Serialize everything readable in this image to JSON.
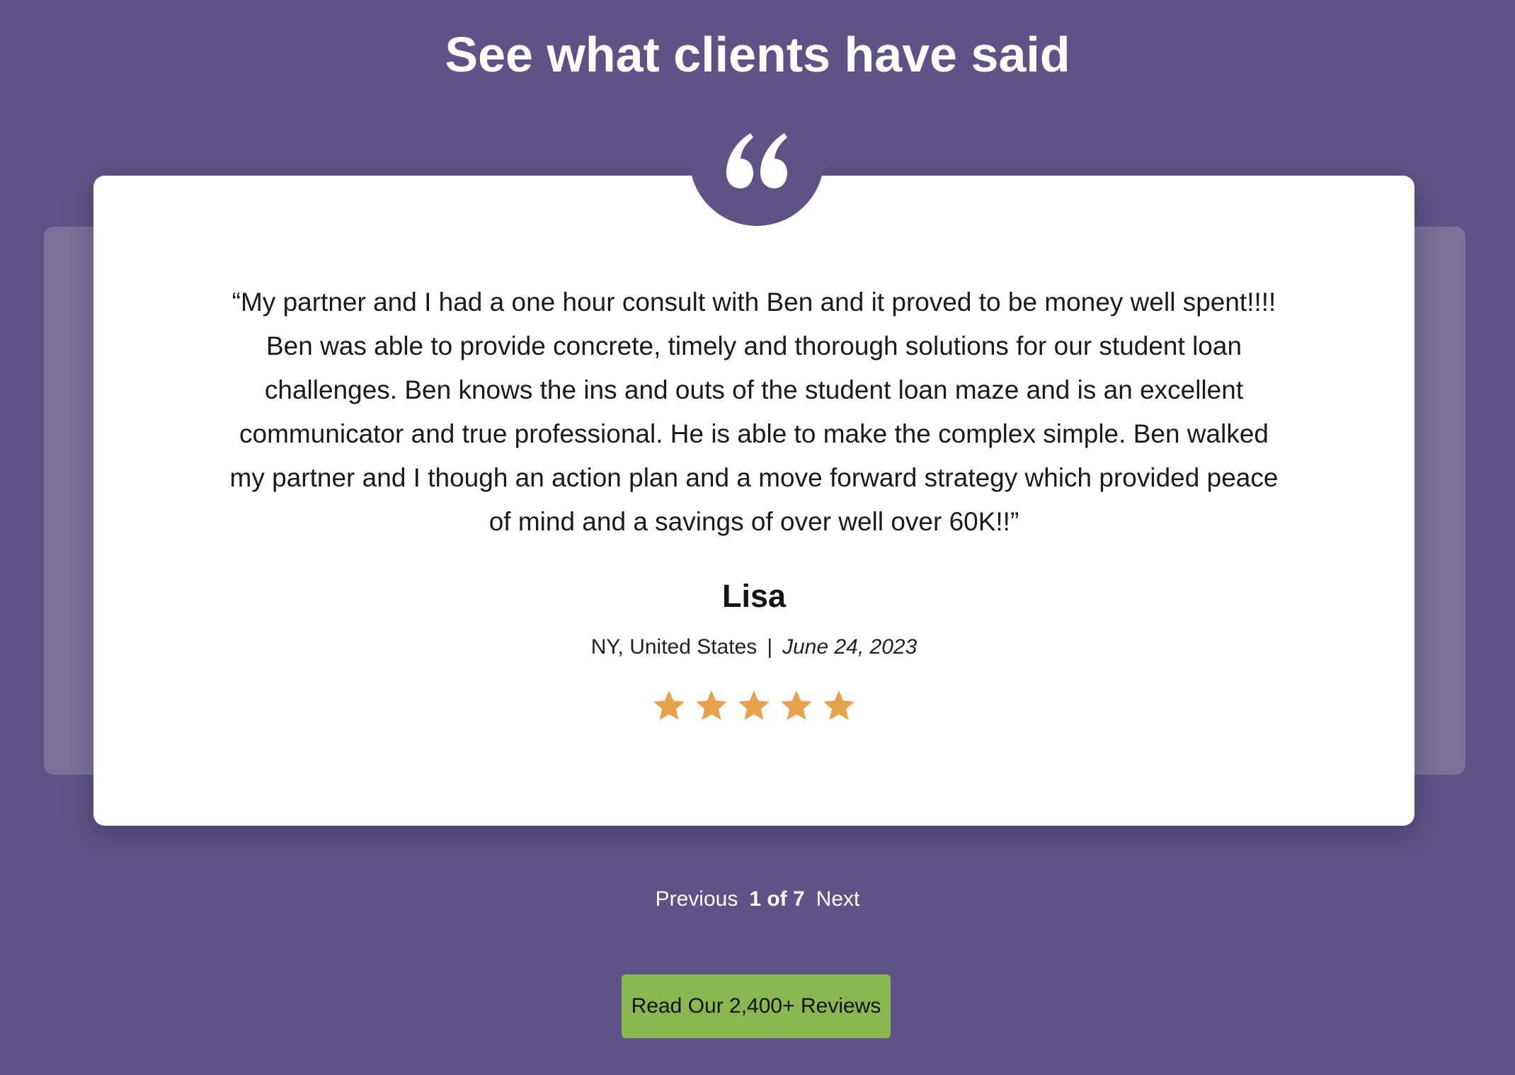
{
  "section": {
    "title": "See what clients have said"
  },
  "testimonial": {
    "quote": "“My partner and I had a one hour consult with Ben and it proved to be money well spent!!!! Ben was able to provide concrete, timely and thorough solutions for our student loan challenges. Ben knows the ins and outs of the student loan maze and is an excellent communicator and true professional. He is able to make the complex simple. Ben walked my partner and I though an action plan and a move forward strategy which provided peace of mind and a savings of over well over 60K!!”",
    "name": "Lisa",
    "location": "NY, United States",
    "separator": "|",
    "date": "June 24, 2023",
    "rating": 5,
    "rating_max": 5,
    "star_color": "#e8a14c",
    "quote_icon": "quote-mark-icon"
  },
  "pagination": {
    "previous_label": "Previous",
    "current_label": "1 of 7",
    "next_label": "Next"
  },
  "cta": {
    "label": "Read Our 2,400+ Reviews",
    "color": "#8ab850"
  },
  "colors": {
    "background": "#5f5286",
    "card": "#ffffff",
    "back_card": "#7c7199"
  }
}
